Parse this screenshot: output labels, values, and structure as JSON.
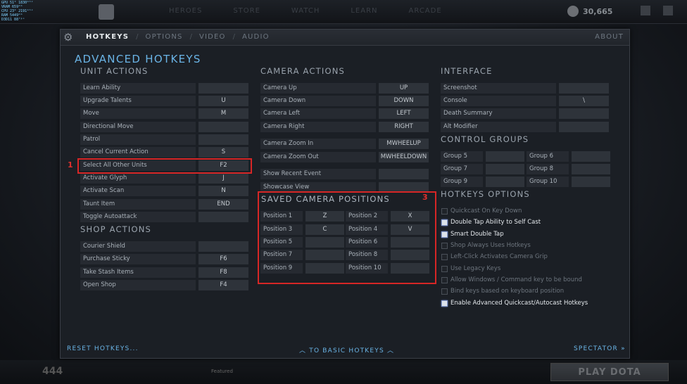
{
  "overlay": {
    "lines": [
      "GPU   51°   1830ᵐʰᶻ",
      "VRAM  659ᵐᵇ",
      "CPU   23°   2191ᵐʰᶻ",
      "RAM   5449ᵐᵇ",
      "D3D11  88ᶠᵖˢ"
    ]
  },
  "topnav": [
    "HEROES",
    "STORE",
    "WATCH",
    "LEARN",
    "ARCADE"
  ],
  "shards": "30,665",
  "bottom": {
    "count": "444",
    "featured": "Featured"
  },
  "play_button": "PLAY DOTA",
  "settings": {
    "tabs": [
      {
        "label": "HOTKEYS",
        "active": true
      },
      {
        "label": "OPTIONS",
        "active": false
      },
      {
        "label": "VIDEO",
        "active": false
      },
      {
        "label": "AUDIO",
        "active": false
      }
    ],
    "about": "ABOUT",
    "title": "ADVANCED HOTKEYS",
    "reset": "RESET HOTKEYS...",
    "to_basic": "TO BASIC HOTKEYS",
    "spectator": "SPECTATOR"
  },
  "unit_actions": {
    "title": "UNIT ACTIONS",
    "rows": [
      {
        "label": "Learn Ability",
        "key": ""
      },
      {
        "label": "Upgrade Talents",
        "key": "U"
      },
      {
        "label": "Move",
        "key": "M"
      },
      {
        "label": "Directional Move",
        "key": ""
      },
      {
        "label": "Patrol",
        "key": ""
      },
      {
        "label": "Cancel Current Action",
        "key": "S"
      },
      {
        "label": "Select All Other Units",
        "key": "F2"
      },
      {
        "label": "Activate Glyph",
        "key": "J"
      },
      {
        "label": "Activate Scan",
        "key": "N"
      },
      {
        "label": "Taunt Item",
        "key": "END"
      },
      {
        "label": "Toggle Autoattack",
        "key": ""
      }
    ]
  },
  "shop_actions": {
    "title": "SHOP ACTIONS",
    "rows": [
      {
        "label": "Courier Shield",
        "key": ""
      },
      {
        "label": "Purchase Sticky",
        "key": "F6"
      },
      {
        "label": "Take Stash Items",
        "key": "F8"
      },
      {
        "label": "Open Shop",
        "key": "F4"
      }
    ]
  },
  "camera_actions": {
    "title": "CAMERA ACTIONS",
    "rows": [
      {
        "label": "Camera Up",
        "key": "UP"
      },
      {
        "label": "Camera Down",
        "key": "DOWN"
      },
      {
        "label": "Camera Left",
        "key": "LEFT"
      },
      {
        "label": "Camera Right",
        "key": "RIGHT"
      },
      {
        "label": "Camera Zoom In",
        "key": "MWHEELUP"
      },
      {
        "label": "Camera Zoom Out",
        "key": "MWHEELDOWN"
      },
      {
        "label": "Show Recent Event",
        "key": ""
      },
      {
        "label": "Showcase View",
        "key": ""
      }
    ]
  },
  "saved_camera": {
    "title": "SAVED CAMERA POSITIONS",
    "rows": [
      [
        {
          "label": "Position 1",
          "key": "Z"
        },
        {
          "label": "Position 2",
          "key": "X"
        }
      ],
      [
        {
          "label": "Position 3",
          "key": "C"
        },
        {
          "label": "Position 4",
          "key": "V"
        }
      ],
      [
        {
          "label": "Position 5",
          "key": ""
        },
        {
          "label": "Position 6",
          "key": ""
        }
      ],
      [
        {
          "label": "Position 7",
          "key": ""
        },
        {
          "label": "Position 8",
          "key": ""
        }
      ],
      [
        {
          "label": "Position 9",
          "key": ""
        },
        {
          "label": "Position 10",
          "key": ""
        }
      ]
    ]
  },
  "interface": {
    "title": "INTERFACE",
    "rows": [
      {
        "label": "Screenshot",
        "key": ""
      },
      {
        "label": "Console",
        "key": "\\"
      },
      {
        "label": "Death Summary",
        "key": ""
      },
      {
        "label": "Alt Modifier",
        "key": ""
      }
    ]
  },
  "control_groups": {
    "title": "CONTROL GROUPS",
    "rows": [
      [
        {
          "label": "Group 5",
          "key": ""
        },
        {
          "label": "Group 6",
          "key": ""
        }
      ],
      [
        {
          "label": "Group 7",
          "key": ""
        },
        {
          "label": "Group 8",
          "key": ""
        }
      ],
      [
        {
          "label": "Group 9",
          "key": ""
        },
        {
          "label": "Group 10",
          "key": ""
        }
      ]
    ]
  },
  "hotkey_options": {
    "title": "HOTKEYS OPTIONS",
    "items": [
      {
        "label": "Quickcast On Key Down",
        "checked": false
      },
      {
        "label": "Double Tap Ability to Self Cast",
        "checked": true
      },
      {
        "label": "Smart Double Tap",
        "checked": true
      },
      {
        "label": "Shop Always Uses Hotkeys",
        "checked": false
      },
      {
        "label": "Left-Click Activates Camera Grip",
        "checked": false
      },
      {
        "label": "Use Legacy Keys",
        "checked": false
      },
      {
        "label": "Allow Windows / Command key to be bound",
        "checked": false
      },
      {
        "label": "Bind keys based on keyboard position",
        "checked": false
      },
      {
        "label": "Enable Advanced Quickcast/Autocast Hotkeys",
        "checked": true
      }
    ]
  },
  "annotations": {
    "label_1": "1",
    "label_3": "3",
    "color": "#d62626"
  }
}
